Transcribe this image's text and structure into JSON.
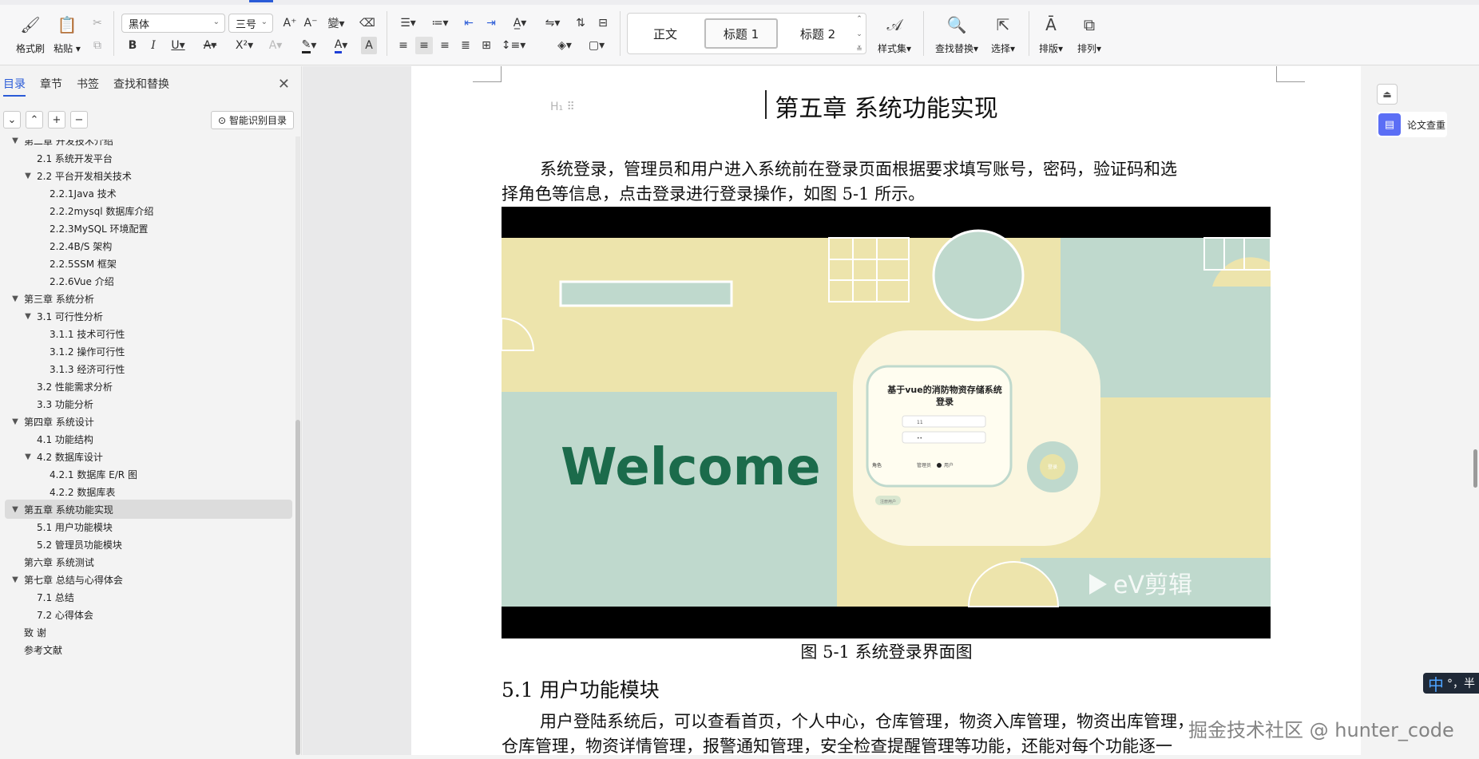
{
  "toolbar": {
    "format_painter": "格式刷",
    "paste": "粘贴",
    "font_name": "黑体",
    "font_size": "三号",
    "styles": [
      "正文",
      "标题 1",
      "标题 2"
    ],
    "style_set": "样式集",
    "find_replace": "查找替换",
    "select": "选择",
    "layout": "排版",
    "arrange": "排列"
  },
  "nav": {
    "tabs": [
      "目录",
      "章节",
      "书签",
      "查找和替换"
    ],
    "active_tab": "目录",
    "smart_toc": "智能识别目录",
    "items": [
      {
        "label": "第二章 开发技术介绍",
        "level": 0,
        "caret": true,
        "partial": true
      },
      {
        "label": "2.1 系统开发平台",
        "level": 1,
        "caret": false
      },
      {
        "label": "2.2 平台开发相关技术",
        "level": 1,
        "caret": true
      },
      {
        "label": "2.2.1Java 技术",
        "level": 2,
        "caret": false
      },
      {
        "label": "2.2.2mysql 数据库介绍",
        "level": 2,
        "caret": false
      },
      {
        "label": "2.2.3MySQL 环境配置",
        "level": 2,
        "caret": false
      },
      {
        "label": "2.2.4B/S 架构",
        "level": 2,
        "caret": false
      },
      {
        "label": "2.2.5SSM 框架",
        "level": 2,
        "caret": false
      },
      {
        "label": "2.2.6Vue 介绍",
        "level": 2,
        "caret": false
      },
      {
        "label": "第三章 系统分析",
        "level": 0,
        "caret": true
      },
      {
        "label": "3.1 可行性分析",
        "level": 1,
        "caret": true
      },
      {
        "label": "3.1.1 技术可行性",
        "level": 2,
        "caret": false
      },
      {
        "label": "3.1.2 操作可行性",
        "level": 2,
        "caret": false
      },
      {
        "label": "3.1.3 经济可行性",
        "level": 2,
        "caret": false
      },
      {
        "label": "3.2 性能需求分析",
        "level": 1,
        "caret": false
      },
      {
        "label": "3.3 功能分析",
        "level": 1,
        "caret": false
      },
      {
        "label": "第四章 系统设计",
        "level": 0,
        "caret": true
      },
      {
        "label": "4.1 功能结构",
        "level": 1,
        "caret": false
      },
      {
        "label": "4.2 数据库设计",
        "level": 1,
        "caret": true
      },
      {
        "label": "4.2.1 数据库 E/R 图",
        "level": 2,
        "caret": false
      },
      {
        "label": "4.2.2 数据库表",
        "level": 2,
        "caret": false
      },
      {
        "label": "第五章 系统功能实现",
        "level": 0,
        "caret": true,
        "current": true
      },
      {
        "label": "5.1 用户功能模块",
        "level": 1,
        "caret": false
      },
      {
        "label": "5.2 管理员功能模块",
        "level": 1,
        "caret": false
      },
      {
        "label": "第六章 系统测试",
        "level": 0,
        "caret": false
      },
      {
        "label": "第七章 总结与心得体会",
        "level": 0,
        "caret": true
      },
      {
        "label": "7.1 总结",
        "level": 1,
        "caret": false
      },
      {
        "label": "7.2 心得体会",
        "level": 1,
        "caret": false
      },
      {
        "label": "致  谢",
        "level": 0,
        "caret": false
      },
      {
        "label": "参考文献",
        "level": 0,
        "caret": false
      }
    ]
  },
  "document": {
    "heading_marker": "H",
    "chapter_title": "第五章  系统功能实现",
    "intro_line1": "系统登录，管理员和用户进入系统前在登录页面根据要求填写账号，密码，验证码和选",
    "intro_line2": "择角色等信息，点击登录进行登录操作，如图 5-1 所示。",
    "figure": {
      "login_title_line1": "基于vue的消防物资存储系统",
      "login_title_line2": "登录",
      "username_value": "11",
      "password_value": "••",
      "role_label": "角色",
      "role_admin": "管理员",
      "role_user": "用户",
      "login_button": "登录",
      "register_link": "注册用户",
      "welcome": "Welcome",
      "video_brand": "eV剪辑"
    },
    "caption": "图 5-1 系统登录界面图",
    "section_title": "5.1 用户功能模块",
    "section_line1": "用户登陆系统后，可以查看首页，个人中心，仓库管理，物资入库管理，物资出库管理，",
    "section_line2": "仓库管理，物资详情管理，报警通知管理，安全检查提醒管理等功能，还能对每个功能逐一"
  },
  "right_rail": {
    "paper_check": "论文查重"
  },
  "ime": {
    "mode": "中",
    "extra": "°，半"
  },
  "watermark": "掘金技术社区 @ hunter_code"
}
